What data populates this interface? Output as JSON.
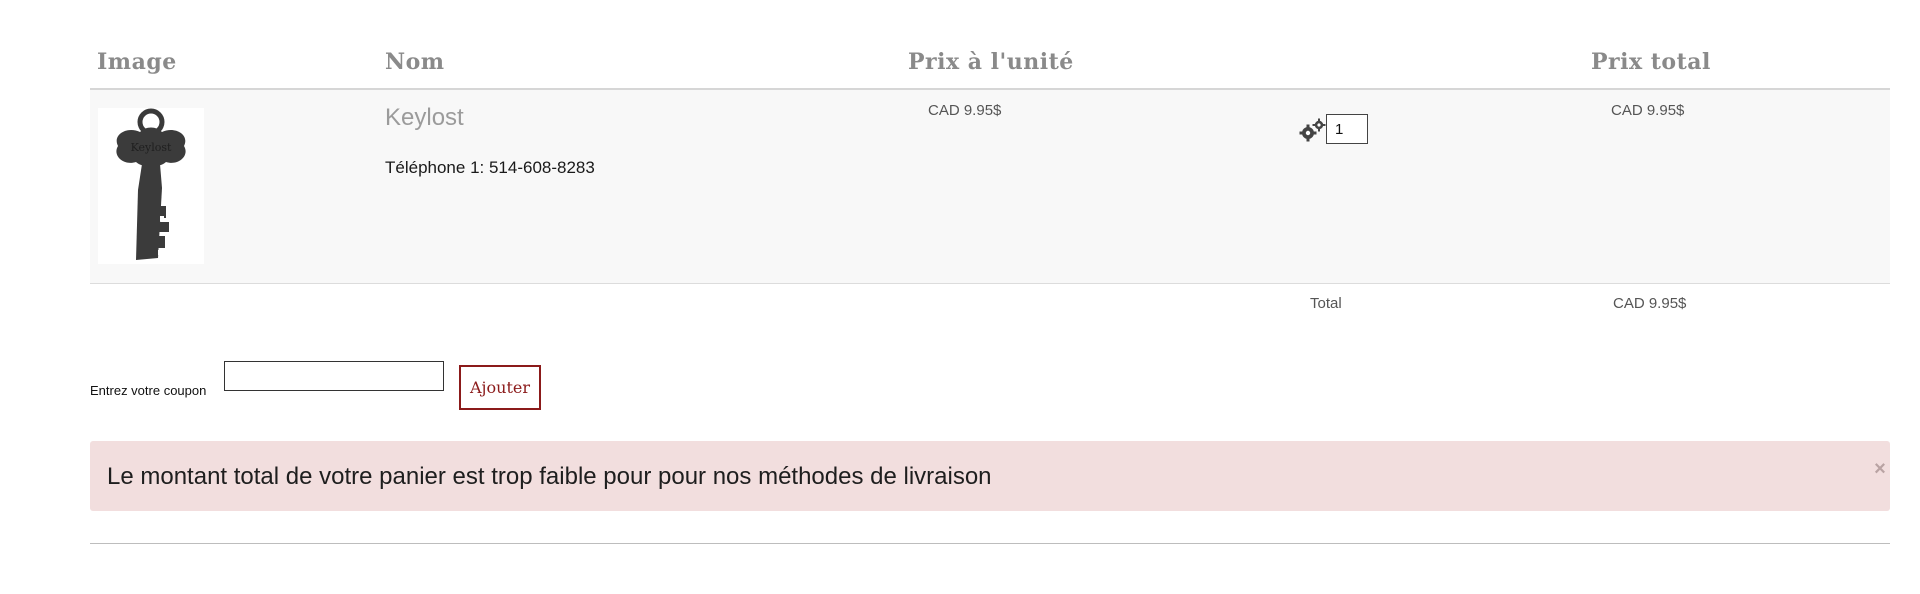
{
  "cart_table": {
    "headers": {
      "image": "Image",
      "name": "Nom",
      "unit_price": "Prix à l'unité",
      "total_price": "Prix total"
    },
    "items": [
      {
        "thumbnail_engraving": "Keylost",
        "name": "Keylost",
        "phone": "Téléphone 1: 514-608-8283",
        "unit_price": "CAD 9.95$",
        "quantity": "1",
        "total_price": "CAD 9.95$",
        "update_icon": "gears-icon"
      }
    ],
    "summary": {
      "total_label": "Total",
      "total_value": "CAD 9.95$"
    }
  },
  "coupon": {
    "label": "Entrez votre coupon",
    "input_value": "",
    "button_label": "Ajouter"
  },
  "alert": {
    "message": "Le montant total de votre panier est trop faible pour pour nos méthodes de livraison",
    "close_label": "×"
  },
  "colors": {
    "header_text": "#8a8a8a",
    "row_background": "#f8f8f8",
    "accent": "#8b1a1a",
    "alert_background": "#f2dede"
  }
}
